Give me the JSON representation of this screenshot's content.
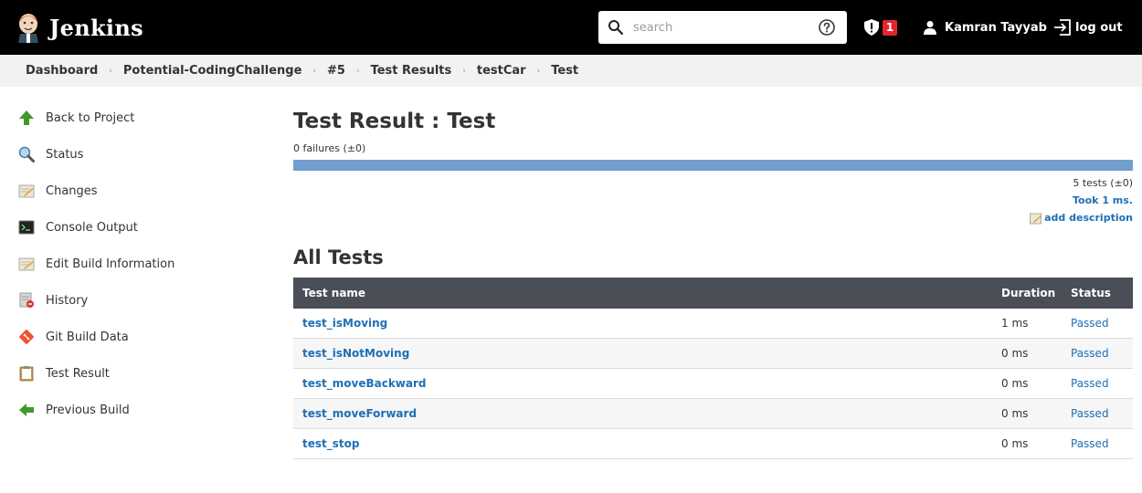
{
  "header": {
    "brand": "Jenkins",
    "search_placeholder": "search",
    "security_count": "1",
    "user_name": "Kamran Tayyab",
    "logout_label": "log out"
  },
  "breadcrumb": [
    "Dashboard",
    "Potential-CodingChallenge",
    "#5",
    "Test Results",
    "testCar",
    "Test"
  ],
  "sidebar": {
    "items": [
      {
        "label": "Back to Project",
        "icon": "up-arrow-icon"
      },
      {
        "label": "Status",
        "icon": "magnifier-icon"
      },
      {
        "label": "Changes",
        "icon": "notepad-icon"
      },
      {
        "label": "Console Output",
        "icon": "terminal-icon"
      },
      {
        "label": "Edit Build Information",
        "icon": "notepad-icon"
      },
      {
        "label": "History",
        "icon": "notepad-no-icon"
      },
      {
        "label": "Git Build Data",
        "icon": "git-icon"
      },
      {
        "label": "Test Result",
        "icon": "clipboard-icon"
      },
      {
        "label": "Previous Build",
        "icon": "left-arrow-icon"
      }
    ]
  },
  "main": {
    "title": "Test Result : Test",
    "failures": "0 failures (±0)",
    "progress_fraction": 1.0,
    "tests_count": "5 tests (±0)",
    "took": "Took 1 ms.",
    "add_description": "add description",
    "all_tests_heading": "All Tests",
    "table": {
      "headers": [
        "Test name",
        "Duration",
        "Status"
      ],
      "rows": [
        {
          "name": "test_isMoving",
          "duration": "1 ms",
          "status": "Passed"
        },
        {
          "name": "test_isNotMoving",
          "duration": "0 ms",
          "status": "Passed"
        },
        {
          "name": "test_moveBackward",
          "duration": "0 ms",
          "status": "Passed"
        },
        {
          "name": "test_moveForward",
          "duration": "0 ms",
          "status": "Passed"
        },
        {
          "name": "test_stop",
          "duration": "0 ms",
          "status": "Passed"
        }
      ]
    }
  },
  "colors": {
    "header_bg": "#000000",
    "breadcrumb_bg": "#f2f2f0",
    "table_header_bg": "#4a4f57",
    "link": "#1e6fb5",
    "progress": "#729fcf",
    "badge": "#e3262c"
  }
}
